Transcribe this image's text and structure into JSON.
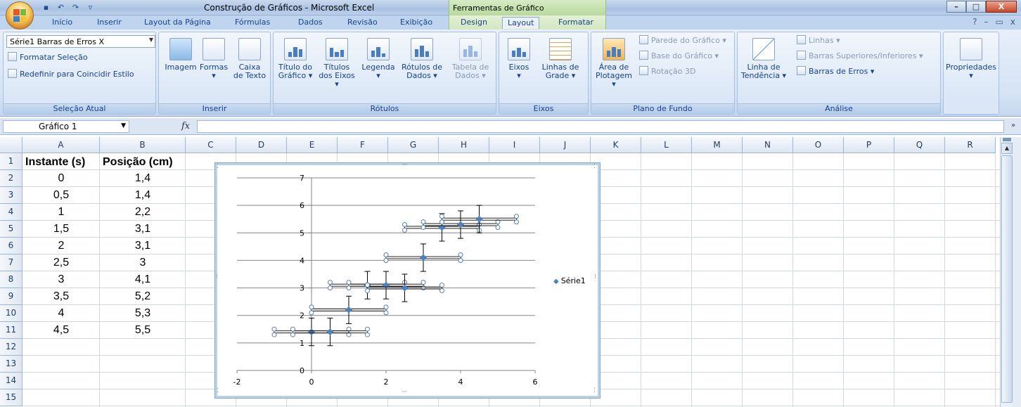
{
  "window": {
    "title": "Construção de Gráficos - Microsoft Excel",
    "context_title": "Ferramentas de Gráfico",
    "controls": [
      "–",
      "□",
      "X"
    ]
  },
  "tabs": [
    "Início",
    "Inserir",
    "Layout da Página",
    "Fórmulas",
    "Dados",
    "Revisão",
    "Exibição",
    "Design",
    "Layout",
    "Formatar"
  ],
  "active_tab": "Layout",
  "help_controls": [
    "?",
    "–",
    "▭",
    "x"
  ],
  "ribbon": {
    "selection": {
      "combo_value": "Série1 Barras de Erros X",
      "format": "Formatar Seleção",
      "reset": "Redefinir para Coincidir Estilo",
      "label": "Seleção Atual"
    },
    "insert": {
      "buttons": [
        [
          "Imagem"
        ],
        [
          "Formas",
          "▾"
        ],
        [
          "Caixa",
          "de Texto"
        ]
      ],
      "label": "Inserir"
    },
    "labels": {
      "buttons": [
        [
          "Título do",
          "Gráfico ▾"
        ],
        [
          "Títulos",
          "dos Eixos ▾"
        ],
        [
          "Legenda",
          "▾"
        ],
        [
          "Rótulos de",
          "Dados ▾"
        ],
        [
          "Tabela de",
          "Dados ▾"
        ]
      ],
      "label": "Rótulos"
    },
    "axes": {
      "buttons": [
        [
          "Eixos",
          "▾"
        ],
        [
          "Linhas de",
          "Grade ▾"
        ]
      ],
      "label": "Eixos"
    },
    "background": {
      "big": [
        "Área de",
        "Plotagem ▾"
      ],
      "wall": "Parede do Gráfico ▾",
      "floor": "Base do Gráfico ▾",
      "rotation": "Rotação 3D",
      "label": "Plano de Fundo"
    },
    "analysis": {
      "big": [
        "Linha de",
        "Tendência ▾"
      ],
      "lines": "Linhas ▾",
      "updown": "Barras Superiores/Inferiores ▾",
      "errorbars": "Barras de Erros ▾",
      "label": "Análise"
    },
    "properties": {
      "button": [
        "Propriedades",
        "▾"
      ]
    }
  },
  "formula_bar": {
    "name_box": "Gráfico 1",
    "fx": "fx",
    "formula": ""
  },
  "columns": [
    "A",
    "B",
    "C",
    "D",
    "E",
    "F",
    "G",
    "H",
    "I",
    "J",
    "K",
    "L",
    "M",
    "N",
    "O",
    "P",
    "Q",
    "R"
  ],
  "rows": [
    "1",
    "2",
    "3",
    "4",
    "5",
    "6",
    "7",
    "8",
    "9",
    "10",
    "11",
    "12",
    "13",
    "14",
    "15"
  ],
  "sheet": {
    "headers": [
      "Instante (s)",
      "Posição (cm)"
    ],
    "data": [
      [
        "0",
        "1,4"
      ],
      [
        "0,5",
        "1,4"
      ],
      [
        "1",
        "2,2"
      ],
      [
        "1,5",
        "3,1"
      ],
      [
        "2",
        "3,1"
      ],
      [
        "2,5",
        "3"
      ],
      [
        "3",
        "4,1"
      ],
      [
        "3,5",
        "5,2"
      ],
      [
        "4",
        "5,3"
      ],
      [
        "4,5",
        "5,5"
      ]
    ]
  },
  "chart_data": {
    "type": "scatter",
    "series": [
      {
        "name": "Série1",
        "color": "#4f81bd",
        "x": [
          0,
          0.5,
          1,
          1.5,
          2,
          2.5,
          3,
          3.5,
          4,
          4.5
        ],
        "y": [
          1.4,
          1.4,
          2.2,
          3.1,
          3.1,
          3.0,
          4.1,
          5.2,
          5.3,
          5.5
        ],
        "x_error": 1,
        "y_error": 0.5
      }
    ],
    "xlim": [
      -2,
      6
    ],
    "ylim": [
      0,
      7
    ],
    "x_ticks": [
      "-2",
      "0",
      "2",
      "4",
      "6"
    ],
    "y_ticks": [
      "0",
      "1",
      "2",
      "3",
      "4",
      "5",
      "6",
      "7"
    ],
    "grid": "horizontal major gridlines",
    "legend": "right",
    "legend_entry": "Série1"
  }
}
